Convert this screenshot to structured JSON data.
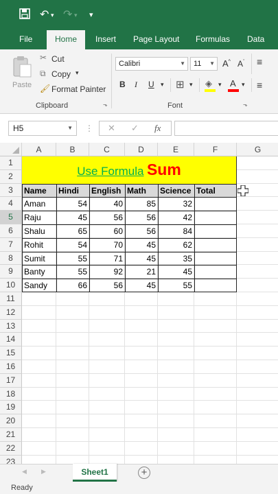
{
  "qat": {
    "save_icon": "save-icon",
    "undo_icon": "undo-icon",
    "redo_icon": "redo-icon",
    "customize_icon": "customize-qat-icon"
  },
  "tabs": [
    "File",
    "Home",
    "Insert",
    "Page Layout",
    "Formulas",
    "Data"
  ],
  "active_tab": "Home",
  "ribbon": {
    "paste_label": "Paste",
    "cut_label": "Cut",
    "copy_label": "Copy",
    "format_painter_label": "Format Painter",
    "clipboard_group": "Clipboard",
    "font_name": "Calibri",
    "font_size": "11",
    "font_group": "Font",
    "bold_label": "B",
    "italic_label": "I",
    "underline_label": "U"
  },
  "formula_bar": {
    "name_box": "H5",
    "cancel_glyph": "✕",
    "enter_glyph": "✓",
    "fx_label": "fx",
    "value": ""
  },
  "columns": [
    "A",
    "B",
    "C",
    "D",
    "E",
    "F",
    "G"
  ],
  "rows": [
    "1",
    "2",
    "3",
    "4",
    "5",
    "6",
    "7",
    "8",
    "9",
    "10",
    "11",
    "12",
    "13",
    "14",
    "15",
    "16",
    "17",
    "18",
    "19",
    "20",
    "21",
    "22",
    "23"
  ],
  "title": {
    "text1": "Use Formula",
    "text2": "Sum",
    "color1": "#00b050",
    "color2": "#ff0000",
    "band_color": "#ffff00"
  },
  "table": {
    "headers": [
      "Name",
      "Hindi",
      "English",
      "Math",
      "Science",
      "Total"
    ],
    "header_fill": "#d9d9d9",
    "rows": [
      [
        "Aman",
        "54",
        "40",
        "85",
        "32",
        ""
      ],
      [
        "Raju",
        "45",
        "56",
        "56",
        "42",
        ""
      ],
      [
        "Shalu",
        "65",
        "60",
        "56",
        "84",
        ""
      ],
      [
        "Rohit",
        "54",
        "70",
        "45",
        "62",
        ""
      ],
      [
        "Sumit",
        "55",
        "71",
        "45",
        "35",
        ""
      ],
      [
        "Banty",
        "55",
        "92",
        "21",
        "45",
        ""
      ],
      [
        "Sandy",
        "66",
        "56",
        "45",
        "55",
        ""
      ]
    ]
  },
  "sheet_tabs": [
    "Sheet1"
  ],
  "status": "Ready",
  "accent": "#217346"
}
